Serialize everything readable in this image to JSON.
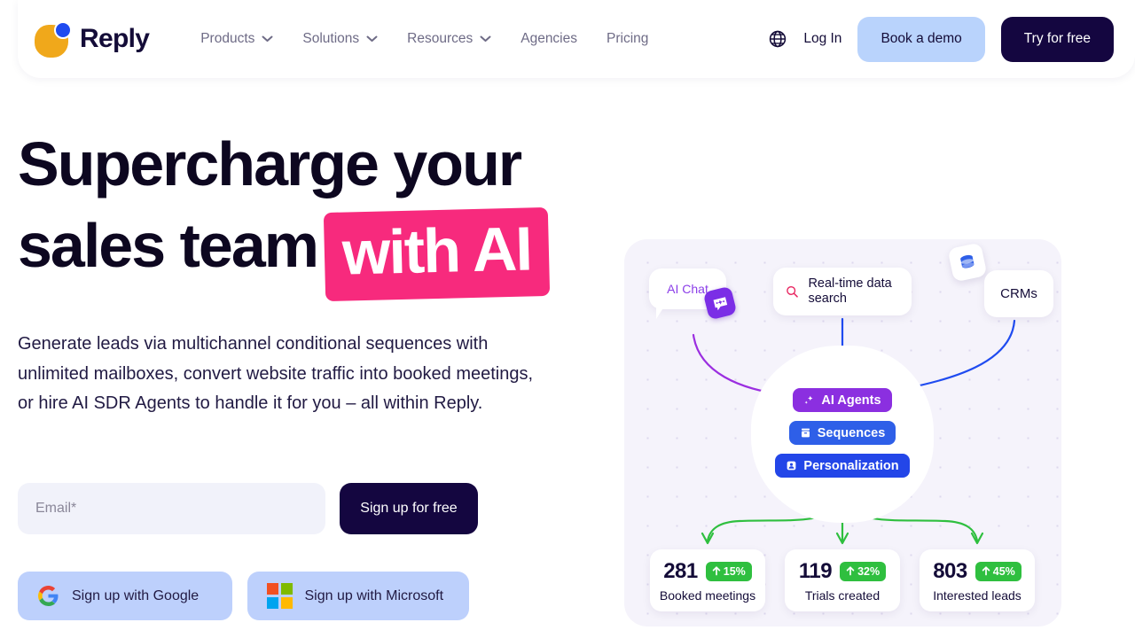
{
  "header": {
    "brand": "Reply",
    "nav": [
      {
        "label": "Products",
        "has_chevron": true,
        "icon": "chevron-down-icon"
      },
      {
        "label": "Solutions",
        "has_chevron": true,
        "icon": "chevron-down-icon"
      },
      {
        "label": "Resources",
        "has_chevron": true,
        "icon": "chevron-down-icon"
      },
      {
        "label": "Agencies",
        "has_chevron": false
      },
      {
        "label": "Pricing",
        "has_chevron": false
      }
    ],
    "language_icon": "globe-icon",
    "login_label": "Log In",
    "demo_label": "Book a demo",
    "try_label": "Try for free",
    "colors": {
      "demo_bg": "#b9d3fc",
      "try_bg": "#140640",
      "brand_text": "#140c38"
    }
  },
  "hero": {
    "headline_line1": "Supercharge your",
    "headline_line2": "sales team",
    "headline_highlight": "with AI",
    "highlight_color": "#f72a7d",
    "subtext": "Generate leads via multichannel conditional sequences with unlimited mailboxes, convert website traffic into booked meetings, or hire AI SDR Agents to handle it for you – all within Reply."
  },
  "signup": {
    "email_placeholder": "Email*",
    "email_value": "",
    "submit_label": "Sign up for free",
    "google_label": "Sign up with Google",
    "google_icon": "google-icon",
    "microsoft_label": "Sign up with Microsoft",
    "microsoft_icon": "microsoft-icon",
    "social_bg": "#bdd0fc"
  },
  "illustration": {
    "background": "#f5f3fb",
    "sources": [
      {
        "label": "AI Chat",
        "icon": "ai-chat-badge-icon",
        "text_color": "#8b3de8"
      },
      {
        "label": "Real-time data search",
        "icon": "search-icon",
        "icon_color": "#e8245f"
      },
      {
        "label": "CRMs",
        "icon": "database-icon",
        "icon_color": "#2e5fe8"
      }
    ],
    "pills": [
      {
        "label": "AI Agents",
        "icon": "sparkle-icon",
        "color": "#8b2fe0"
      },
      {
        "label": "Sequences",
        "icon": "inbox-icon",
        "color": "#2e5fe8"
      },
      {
        "label": "Personalization",
        "icon": "id-card-icon",
        "color": "#2346e8"
      }
    ],
    "stats": [
      {
        "value": "281",
        "delta": "15%",
        "label": "Booked meetings",
        "trend_icon": "arrow-up-icon"
      },
      {
        "value": "119",
        "delta": "32%",
        "label": "Trials created",
        "trend_icon": "arrow-up-icon"
      },
      {
        "value": "803",
        "delta": "45%",
        "label": "Interested leads",
        "trend_icon": "arrow-up-icon"
      }
    ],
    "badge_color": "#2fbf3f"
  }
}
